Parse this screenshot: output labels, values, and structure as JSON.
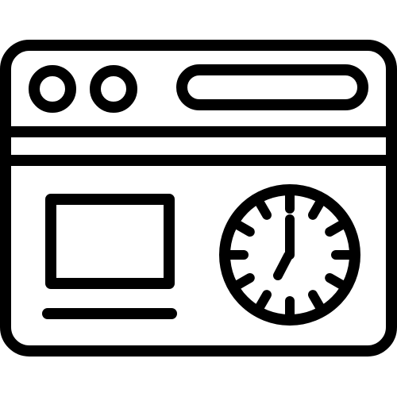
{
  "icon": {
    "name": "browser-window-clock-icon",
    "stroke_color": "#000000",
    "background_color": "#ffffff",
    "clock_time": "07:00"
  }
}
